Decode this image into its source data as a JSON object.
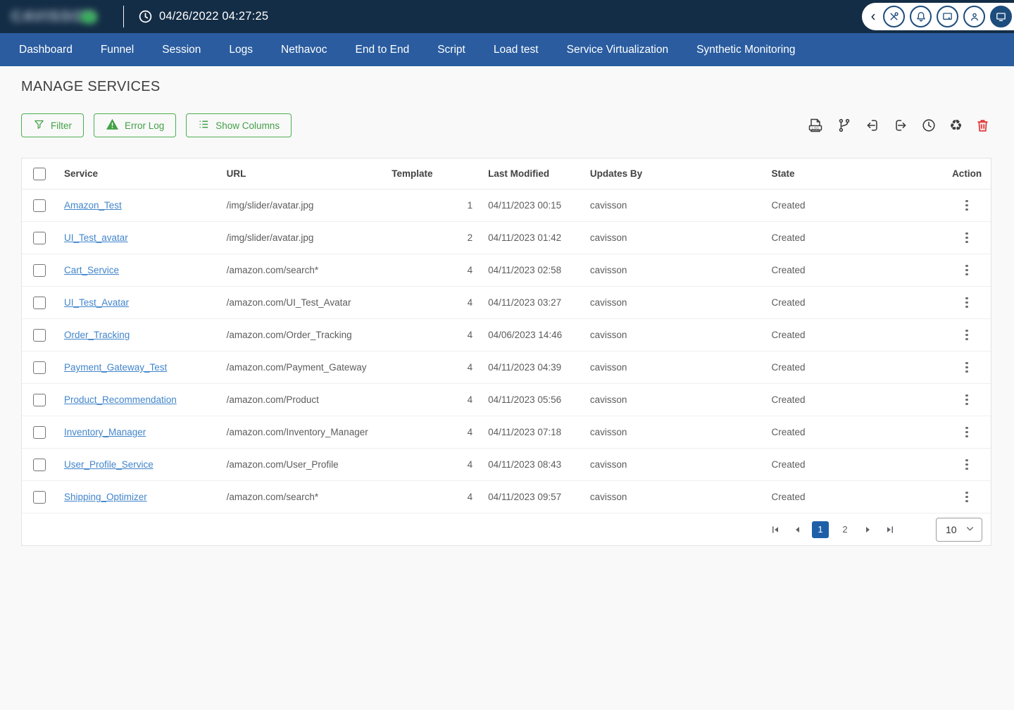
{
  "topbar": {
    "logo_text": "CAVISSON",
    "datetime": "04/26/2022 04:27:25",
    "icons": [
      "chevron-left",
      "tools",
      "notifications",
      "desktop",
      "user",
      "monitor"
    ]
  },
  "nav": {
    "items": [
      "Dashboard",
      "Funnel",
      "Session",
      "Logs",
      "Nethavoc",
      "End to End",
      "Script",
      "Load test",
      "Service Virtualization",
      "Synthetic Monitoring"
    ]
  },
  "page": {
    "title": "MANAGE SERVICES"
  },
  "actions": {
    "filter": "Filter",
    "error_log": "Error Log",
    "show_columns": "Show Columns",
    "log_icon_label": "LOG",
    "toolbar_icons": [
      "log-file",
      "version-branch",
      "import",
      "export",
      "history-clock",
      "recycle",
      "delete"
    ]
  },
  "table": {
    "columns": {
      "service": "Service",
      "url": "URL",
      "template": "Template",
      "last_modified": "Last Modified",
      "updates_by": "Updates By",
      "state": "State",
      "action": "Action"
    },
    "rows": [
      {
        "service": "Amazon_Test",
        "url": "/img/slider/avatar.jpg",
        "template": "1",
        "last_modified": "04/11/2023 00:15",
        "updates_by": "cavisson",
        "state": "Created"
      },
      {
        "service": "UI_Test_avatar",
        "url": "/img/slider/avatar.jpg",
        "template": "2",
        "last_modified": "04/11/2023 01:42",
        "updates_by": "cavisson",
        "state": "Created"
      },
      {
        "service": "Cart_Service",
        "url": "/amazon.com/search*",
        "template": "4",
        "last_modified": "04/11/2023 02:58",
        "updates_by": "cavisson",
        "state": "Created"
      },
      {
        "service": "UI_Test_Avatar",
        "url": "/amazon.com/UI_Test_Avatar",
        "template": "4",
        "last_modified": "04/11/2023 03:27",
        "updates_by": "cavisson",
        "state": "Created"
      },
      {
        "service": "Order_Tracking",
        "url": "/amazon.com/Order_Tracking",
        "template": "4",
        "last_modified": "04/06/2023 14:46",
        "updates_by": "cavisson",
        "state": "Created"
      },
      {
        "service": "Payment_Gateway_Test",
        "url": "/amazon.com/Payment_Gateway",
        "template": "4",
        "last_modified": "04/11/2023 04:39",
        "updates_by": "cavisson",
        "state": "Created"
      },
      {
        "service": "Product_Recommendation",
        "url": "/amazon.com/Product",
        "template": "4",
        "last_modified": "04/11/2023 05:56",
        "updates_by": "cavisson",
        "state": "Created"
      },
      {
        "service": "Inventory_Manager",
        "url": "/amazon.com/Inventory_Manager",
        "template": "4",
        "last_modified": "04/11/2023 07:18",
        "updates_by": "cavisson",
        "state": "Created"
      },
      {
        "service": "User_Profile_Service",
        "url": "/amazon.com/User_Profile",
        "template": "4",
        "last_modified": "04/11/2023 08:43",
        "updates_by": "cavisson",
        "state": "Created"
      },
      {
        "service": "Shipping_Optimizer",
        "url": "/amazon.com/search*",
        "template": "4",
        "last_modified": "04/11/2023 09:57",
        "updates_by": "cavisson",
        "state": "Created"
      }
    ]
  },
  "pagination": {
    "pages": [
      "1",
      "2"
    ],
    "active_page": "1",
    "page_size": "10"
  },
  "colors": {
    "topbar_bg": "#142d46",
    "nav_bg": "#2a5c9f",
    "accent_green": "#4caf50",
    "link_blue": "#4285cb",
    "active_page_bg": "#1e5fa8",
    "danger_red": "#e02b2b"
  }
}
